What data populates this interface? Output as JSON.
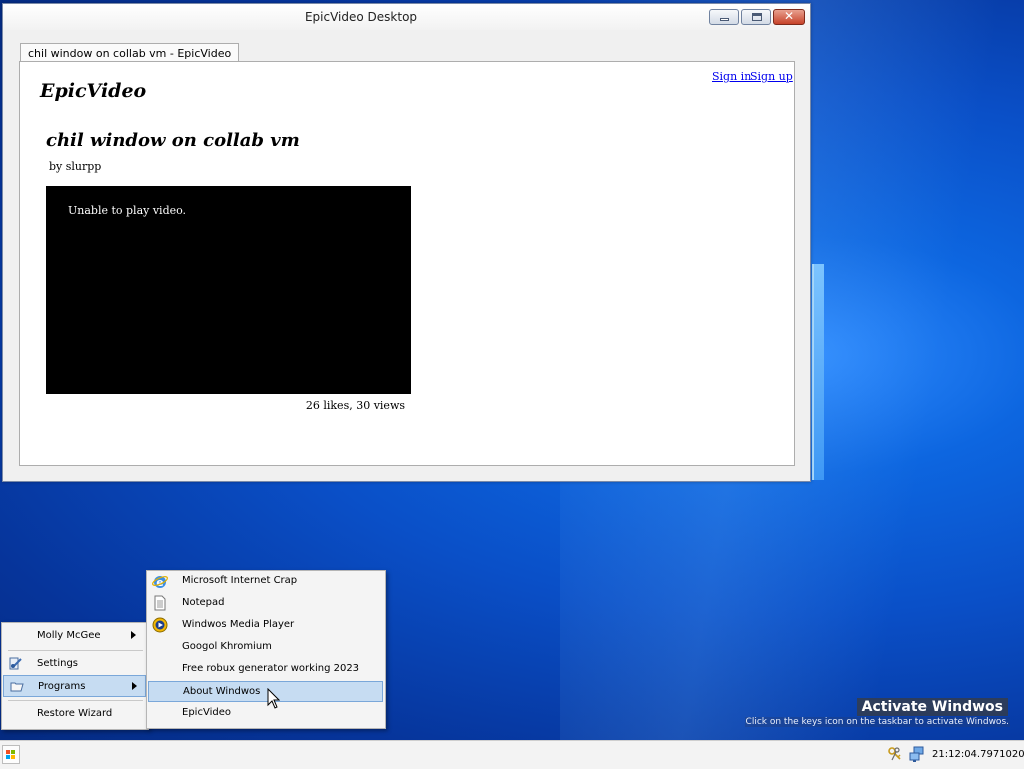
{
  "window": {
    "title": "EpicVideo Desktop",
    "tab_label": "chil window on collab vm - EpicVideo"
  },
  "page": {
    "sign_in": "Sign in",
    "sign_up": "Sign up",
    "site_name": "EpicVideo",
    "video_title": "chil window on collab vm",
    "author": "by slurpp",
    "player_message": "Unable to play video.",
    "stats": "26 likes, 30 views"
  },
  "start_menu": {
    "items": [
      {
        "label": "Molly McGee",
        "icon": "user-icon",
        "has_submenu": true
      },
      {
        "label": "Settings",
        "icon": "settings-icon",
        "has_submenu": false
      },
      {
        "label": "Programs",
        "icon": "folder-icon",
        "has_submenu": true,
        "selected": true
      },
      {
        "label": "Restore Wizard",
        "icon": "",
        "has_submenu": false
      }
    ]
  },
  "programs_menu": {
    "items": [
      {
        "label": "Microsoft Internet Crap",
        "icon": "internet-explorer-icon"
      },
      {
        "label": "Notepad",
        "icon": "notepad-icon"
      },
      {
        "label": "Windwos Media Player",
        "icon": "media-player-icon"
      },
      {
        "label": "Googol Khromium",
        "icon": ""
      },
      {
        "label": "Free robux generator working 2023",
        "icon": ""
      },
      {
        "label": "About Windwos",
        "icon": "",
        "selected": true
      },
      {
        "label": "EpicVideo",
        "icon": ""
      }
    ]
  },
  "watermark": {
    "title": "Activate Windwos",
    "subtitle": "Click on the keys icon on the taskbar to activate Windwos."
  },
  "taskbar": {
    "clock": "21:12:04.7971020",
    "tray_icons": [
      "keys-icon",
      "network-icon"
    ]
  },
  "colors": {
    "desktop_blue": "#0a4fc7",
    "selection": "#c6dcf2",
    "close_red": "#c7432a",
    "link": "#0000ee"
  }
}
